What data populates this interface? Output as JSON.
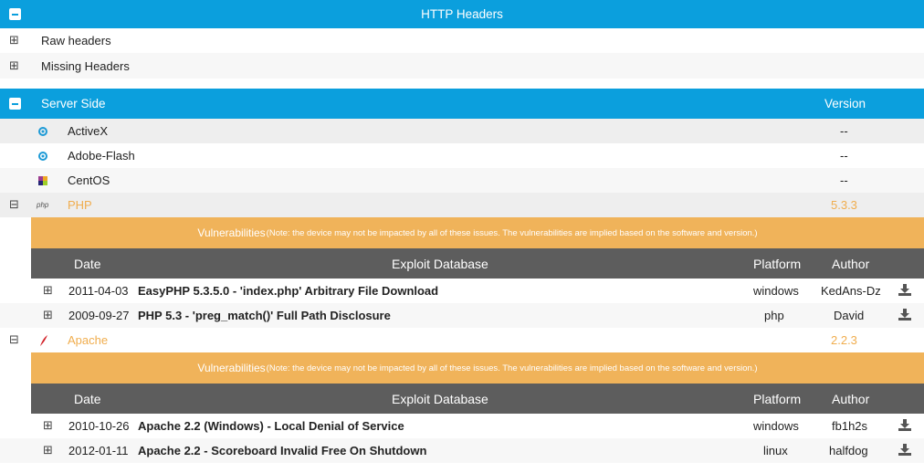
{
  "http_headers": {
    "title": "HTTP Headers",
    "items": [
      {
        "label": "Raw headers"
      },
      {
        "label": "Missing Headers"
      }
    ]
  },
  "server_side": {
    "title": "Server Side",
    "version_header": "Version",
    "items": [
      {
        "name": "ActiveX",
        "version": "--",
        "icon": "activex-icon"
      },
      {
        "name": "Adobe-Flash",
        "version": "--",
        "icon": "flash-icon"
      },
      {
        "name": "CentOS",
        "version": "--",
        "icon": "centos-icon"
      }
    ]
  },
  "php": {
    "icon_text": "php",
    "name": "PHP",
    "version": "5.3.3",
    "vuln_title": "Vulnerabilities",
    "vuln_note": "(Note: the device may not be impacted by all of these issues. The vulnerabilities are implied based on the software and version.)",
    "headers": {
      "date": "Date",
      "exploit": "Exploit Database",
      "platform": "Platform",
      "author": "Author"
    },
    "rows": [
      {
        "date": "2011-04-03",
        "title": "EasyPHP 5.3.5.0 - 'index.php' Arbitrary File Download",
        "platform": "windows",
        "author": "KedAns-Dz"
      },
      {
        "date": "2009-09-27",
        "title": "PHP 5.3 - 'preg_match()' Full Path Disclosure",
        "platform": "php",
        "author": "David"
      }
    ]
  },
  "apache": {
    "name": "Apache",
    "version": "2.2.3",
    "vuln_title": "Vulnerabilities",
    "vuln_note": "(Note: the device may not be impacted by all of these issues. The vulnerabilities are implied based on the software and version.)",
    "headers": {
      "date": "Date",
      "exploit": "Exploit Database",
      "platform": "Platform",
      "author": "Author"
    },
    "rows": [
      {
        "date": "2010-10-26",
        "title": "Apache 2.2 (Windows) - Local Denial of Service",
        "platform": "windows",
        "author": "fb1h2s"
      },
      {
        "date": "2012-01-11",
        "title": "Apache 2.2 - Scoreboard Invalid Free On Shutdown",
        "platform": "linux",
        "author": "halfdog"
      }
    ]
  },
  "colors": {
    "header_blue": "#0b9fdd",
    "accent_orange": "#f0ad4e",
    "table_header": "#5d5d5d"
  }
}
